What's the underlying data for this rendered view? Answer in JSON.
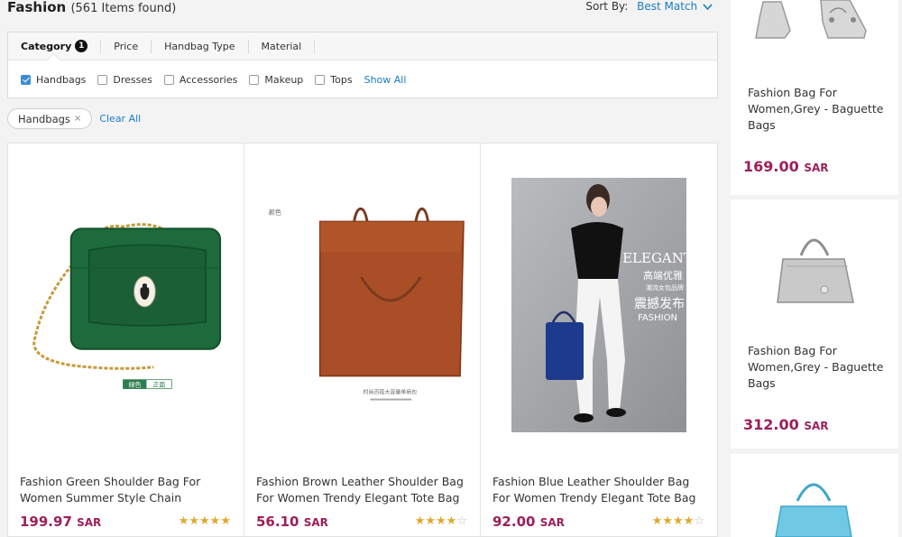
{
  "header": {
    "title": "Fashion",
    "count": "(561 Items found)",
    "sort_label": "Sort By:",
    "sort_value": "Best Match"
  },
  "filters": {
    "tabs": [
      {
        "label": "Category",
        "badge": "1"
      },
      {
        "label": "Price"
      },
      {
        "label": "Handbag Type"
      },
      {
        "label": "Material"
      }
    ],
    "options": [
      {
        "label": "Handbags",
        "checked": true
      },
      {
        "label": "Dresses",
        "checked": false
      },
      {
        "label": "Accessories",
        "checked": false
      },
      {
        "label": "Makeup",
        "checked": false
      },
      {
        "label": "Tops",
        "checked": false
      }
    ],
    "show_all": "Show All"
  },
  "active_filters": {
    "chip": "Handbags",
    "chip_close": "×",
    "clear_all": "Clear All"
  },
  "products": [
    {
      "name_line1": "Fashion Green Shoulder Bag For",
      "name_line2": "Women Summer Style Chain",
      "price": "199.97",
      "currency": "SAR",
      "rating": 4.5,
      "image": "green-shoulder-bag",
      "image_tag1": "绿色",
      "image_tag2": "正面"
    },
    {
      "name_line1": "Fashion Brown Leather Shoulder Bag",
      "name_line2": "For Women Trendy Elegant Tote Bag",
      "price": "56.10",
      "currency": "SAR",
      "rating": 4,
      "image": "brown-tote-bag",
      "image_note": "颜色",
      "image_caption": "时尚百搭大容量单肩包"
    },
    {
      "name_line1": "Fashion Blue Leather Shoulder Bag",
      "name_line2": "For Women Trendy Elegant Tote Bag",
      "price": "92.00",
      "currency": "SAR",
      "rating": 4,
      "image": "blue-tote-model",
      "overlay_title": "ELEGANT",
      "overlay_cn1": "高端优雅",
      "overlay_cn2": "潮流女包品牌",
      "overlay_cn3": "震撼发布",
      "overlay_sub": "FASHION"
    }
  ],
  "sidebar_products": [
    {
      "name_line1": "Fashion Bag For",
      "name_line2": "Women,Grey - Baguette",
      "name_line3": "Bags",
      "price": "169.00",
      "currency": "SAR",
      "image": "grey-bags-pair"
    },
    {
      "name_line1": "Fashion Bag For",
      "name_line2": "Women,Grey - Baguette",
      "name_line3": "Bags",
      "price": "312.00",
      "currency": "SAR",
      "image": "grey-handbag"
    },
    {
      "image": "light-blue-handbag"
    }
  ],
  "colors": {
    "link": "#1a7cc4",
    "price": "#9c1f5b",
    "star": "#e0a82e",
    "checkbox": "#3d8bd4"
  }
}
